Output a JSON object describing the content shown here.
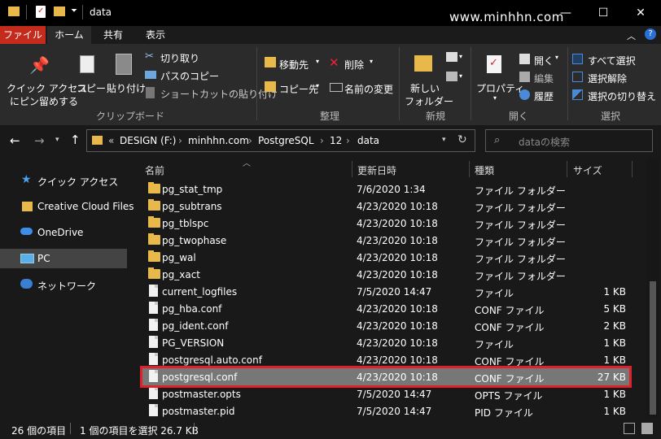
{
  "window": {
    "title": "data",
    "watermark": "www.minhhn.com",
    "min_glyph": "—",
    "max_glyph": "☐",
    "close_glyph": "✕"
  },
  "tabs": [
    {
      "label": "ファイル"
    },
    {
      "label": "ホーム"
    },
    {
      "label": "共有"
    },
    {
      "label": "表示"
    }
  ],
  "ribbon": {
    "clipboard": {
      "pin_label": "クイック アクセス",
      "pin_label2": "にピン留めする",
      "copy": "コピー",
      "paste": "貼り付け",
      "cut": "切り取り",
      "copy_path": "パスのコピー",
      "paste_shortcut": "ショートカットの貼り付け",
      "group": "クリップボード"
    },
    "organize": {
      "move_to": "移動先",
      "copy_to": "コピー先",
      "delete": "削除",
      "rename": "名前の変更",
      "group": "整理"
    },
    "new": {
      "new_folder": "新しい",
      "new_folder2": "フォルダー",
      "group": "新規"
    },
    "open": {
      "properties": "プロパティ",
      "open": "開く",
      "edit": "編集",
      "history": "履歴",
      "group": "開く"
    },
    "select": {
      "select_all": "すべて選択",
      "select_none": "選択解除",
      "invert": "選択の切り替え",
      "group": "選択"
    }
  },
  "address": {
    "prefix": "«",
    "crumbs": [
      "DESIGN (F:)",
      "minhhn.com",
      "PostgreSQL",
      "12",
      "data"
    ],
    "search_placeholder": "dataの検索"
  },
  "nav": [
    {
      "label": "クイック アクセス",
      "icon": "star-icon"
    },
    {
      "label": "Creative Cloud Files",
      "icon": "creative-cloud-folder-icon"
    },
    {
      "label": "OneDrive",
      "icon": "cloud-icon"
    },
    {
      "label": "PC",
      "icon": "pc-icon"
    },
    {
      "label": "ネットワーク",
      "icon": "network-icon"
    }
  ],
  "columns": {
    "name": "名前",
    "modified": "更新日時",
    "type": "種類",
    "size": "サイズ"
  },
  "files": [
    {
      "name": "pg_stat_tmp",
      "date": "7/6/2020 1:34",
      "type": "ファイル フォルダー",
      "size": "",
      "kind": "folder"
    },
    {
      "name": "pg_subtrans",
      "date": "4/23/2020 10:18",
      "type": "ファイル フォルダー",
      "size": "",
      "kind": "folder"
    },
    {
      "name": "pg_tblspc",
      "date": "4/23/2020 10:18",
      "type": "ファイル フォルダー",
      "size": "",
      "kind": "folder"
    },
    {
      "name": "pg_twophase",
      "date": "4/23/2020 10:18",
      "type": "ファイル フォルダー",
      "size": "",
      "kind": "folder"
    },
    {
      "name": "pg_wal",
      "date": "4/23/2020 10:18",
      "type": "ファイル フォルダー",
      "size": "",
      "kind": "folder"
    },
    {
      "name": "pg_xact",
      "date": "4/23/2020 10:18",
      "type": "ファイル フォルダー",
      "size": "",
      "kind": "folder"
    },
    {
      "name": "current_logfiles",
      "date": "7/5/2020 14:47",
      "type": "ファイル",
      "size": "1 KB",
      "kind": "file"
    },
    {
      "name": "pg_hba.conf",
      "date": "4/23/2020 10:18",
      "type": "CONF ファイル",
      "size": "5 KB",
      "kind": "file"
    },
    {
      "name": "pg_ident.conf",
      "date": "4/23/2020 10:18",
      "type": "CONF ファイル",
      "size": "2 KB",
      "kind": "file"
    },
    {
      "name": "PG_VERSION",
      "date": "4/23/2020 10:18",
      "type": "ファイル",
      "size": "1 KB",
      "kind": "file"
    },
    {
      "name": "postgresql.auto.conf",
      "date": "4/23/2020 10:18",
      "type": "CONF ファイル",
      "size": "1 KB",
      "kind": "file"
    },
    {
      "name": "postgresql.conf",
      "date": "4/23/2020 10:18",
      "type": "CONF ファイル",
      "size": "27 KB",
      "kind": "file",
      "selected": true
    },
    {
      "name": "postmaster.opts",
      "date": "7/5/2020 14:47",
      "type": "OPTS ファイル",
      "size": "1 KB",
      "kind": "file"
    },
    {
      "name": "postmaster.pid",
      "date": "7/5/2020 14:47",
      "type": "PID ファイル",
      "size": "1 KB",
      "kind": "file"
    }
  ],
  "status": {
    "item_count": "26 個の項目",
    "selection": "1 個の項目を選択 26.7 KB"
  },
  "colors": {
    "accent_file_tab": "#c42b1c",
    "selection_row": "#777777",
    "highlight_box": "#e0202a",
    "folder": "#e8b84a"
  }
}
